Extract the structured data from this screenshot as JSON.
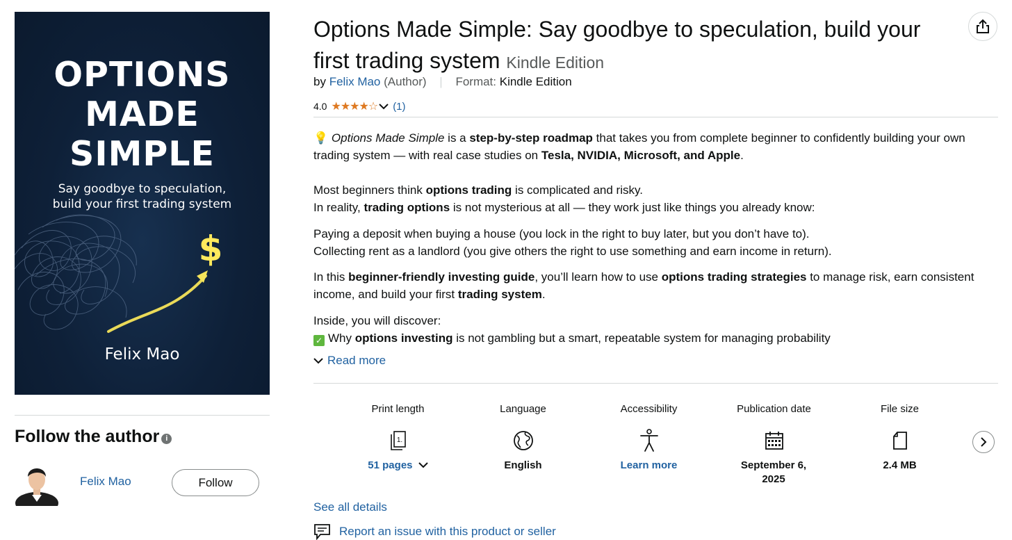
{
  "cover": {
    "title": "OPTIONS\nMADE\nSIMPLE",
    "subtitle": "Say goodbye to speculation,\nbuild your first trading system",
    "symbol": "$",
    "author": "Felix Mao",
    "bg_color": "#0e2038",
    "accent_color": "#f5e45a"
  },
  "follow": {
    "heading": "Follow the author",
    "info_icon": "info-icon",
    "author_name": "Felix Mao",
    "follow_label": "Follow"
  },
  "product": {
    "title": "Options Made Simple: Say goodbye to speculation, build your first trading system",
    "edition": "Kindle Edition",
    "by": "by",
    "author": "Felix Mao",
    "author_role": "(Author)",
    "separator": "|",
    "format_label": "Format:",
    "format_value": "Kindle Edition",
    "rating": "4.0",
    "stars": "★★★★☆",
    "star_value": 4.0,
    "rating_count": "(1)",
    "share_icon": "share-icon"
  },
  "description": {
    "p1_emoji": "💡",
    "p1_a": "Options Made Simple",
    "p1_b": " is a ",
    "p1_c": "step-by-step roadmap",
    "p1_d": " that takes you from complete beginner to confidently building your own trading system — with real case studies on ",
    "p1_e": "Tesla, NVIDIA, Microsoft, and Apple",
    "p1_f": ".",
    "p2_a": "Most beginners think ",
    "p2_b": "options trading",
    "p2_c": " is complicated and risky.",
    "p2_d": "In reality, ",
    "p2_e": "trading options",
    "p2_f": " is not mysterious at all — they work just like things you already know:",
    "p3_a": "Paying a deposit when buying a house (you lock in the right to buy later, but you don’t have to).",
    "p3_b": "Collecting rent as a landlord (you give others the right to use something and earn income in return).",
    "p4_a": "In this ",
    "p4_b": "beginner-friendly investing guide",
    "p4_c": ", you’ll learn how to use ",
    "p4_d": "options trading strategies",
    "p4_e": " to manage risk, earn consistent income, and build your first ",
    "p4_f": "trading system",
    "p4_g": ".",
    "p5_a": "Inside, you will discover:",
    "p5_check": "✓",
    "p5_b": "Why ",
    "p5_c": "options investing",
    "p5_d": " is not gambling but a smart, repeatable system for managing probability",
    "read_more": "Read more"
  },
  "details": [
    {
      "label": "Print length",
      "icon": "book-pages-icon",
      "value": "51 pages",
      "has_dropdown": true,
      "is_link": true
    },
    {
      "label": "Language",
      "icon": "globe-icon",
      "value": "English",
      "has_dropdown": false,
      "is_link": false
    },
    {
      "label": "Accessibility",
      "icon": "accessibility-icon",
      "value": "Learn more",
      "has_dropdown": false,
      "is_link": true
    },
    {
      "label": "Publication date",
      "icon": "calendar-icon",
      "value": "September 6, 2025",
      "has_dropdown": false,
      "is_link": false
    },
    {
      "label": "File size",
      "icon": "file-icon",
      "value": "2.4 MB",
      "has_dropdown": false,
      "is_link": false
    }
  ],
  "links": {
    "see_all": "See all details",
    "report": "Report an issue with this product or seller"
  },
  "colors": {
    "link": "#2162a1",
    "star": "#de7921",
    "divider": "#d5d9d9"
  }
}
